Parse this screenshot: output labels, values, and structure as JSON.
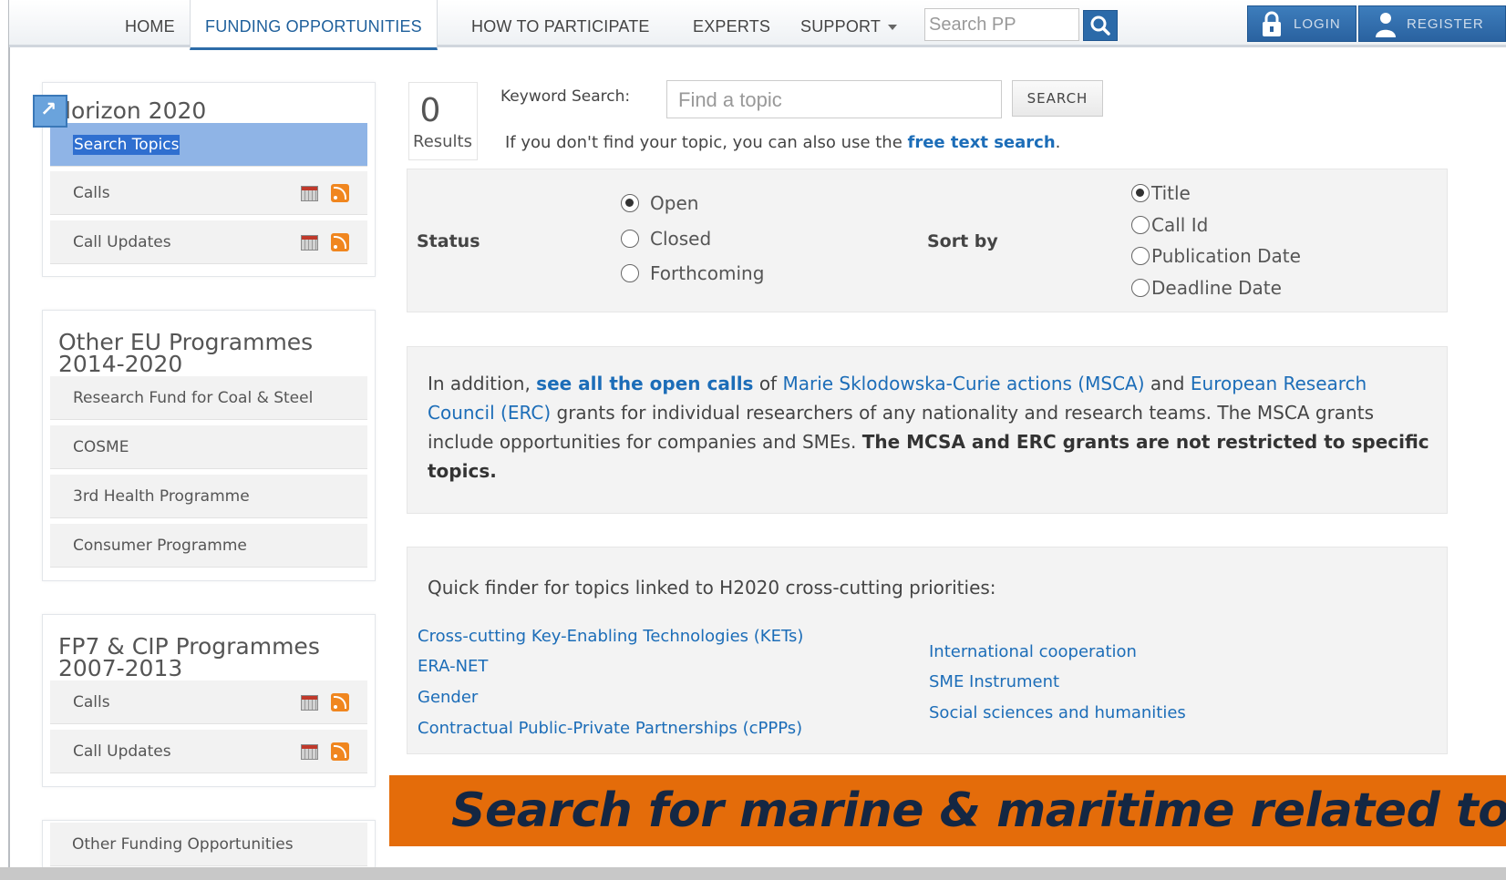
{
  "nav": {
    "items": [
      {
        "label": "HOME",
        "active": false
      },
      {
        "label": "FUNDING OPPORTUNITIES",
        "active": true
      },
      {
        "label": "HOW TO PARTICIPATE",
        "active": false
      },
      {
        "label": "EXPERTS",
        "active": false
      },
      {
        "label": "SUPPORT",
        "active": false
      }
    ],
    "search_placeholder": "Search PP",
    "login_label": "LOGIN",
    "register_label": "REGISTER",
    "accent_color": "#2b6aa9"
  },
  "sidebar": {
    "horizon": {
      "title": "Horizon 2020",
      "title_visible": "lorizon 2020",
      "items": [
        "Search Topics",
        "Calls",
        "Call Updates"
      ]
    },
    "other_eu": {
      "title_line1": "Other EU Programmes",
      "title_line2": "2014-2020",
      "items": [
        "Research Fund for Coal & Steel",
        "COSME",
        "3rd Health Programme",
        "Consumer Programme"
      ]
    },
    "fp7": {
      "title_line1": "FP7 & CIP Programmes",
      "title_line2": "2007-2013",
      "items": [
        "Calls",
        "Call Updates"
      ]
    },
    "other_funding": "Other Funding Opportunities"
  },
  "search": {
    "results_count": "0",
    "results_label": "Results",
    "keyword_label": "Keyword Search:",
    "keyword_placeholder": "Find a topic",
    "search_button": "SEARCH",
    "hint_prefix": "If you don't find your topic, you can also use the",
    "hint_link": "free text search",
    "hint_suffix": "."
  },
  "filters": {
    "status_label": "Status",
    "status_options": [
      "Open",
      "Closed",
      "Forthcoming"
    ],
    "status_selected": "Open",
    "sort_label": "Sort by",
    "sort_options": [
      "Title",
      "Call Id",
      "Publication Date",
      "Deadline Date"
    ],
    "sort_selected": "Title"
  },
  "info": {
    "t1": "In addition,",
    "link1": "see all the open calls",
    "t2": "of",
    "link2": "Marie Sklodowska-Curie actions (MSCA)",
    "t3": "and",
    "link3": "European Research Council (ERC)",
    "t4": "grants for individual researchers of any nationality and research teams. The MSCA grants include opportunities for companies and SMEs.",
    "bold": "The MCSA and ERC grants are not restricted to specific topics."
  },
  "quick": {
    "title": "Quick finder for topics linked to H2020 cross-cutting priorities:",
    "left": [
      "Cross-cutting Key-Enabling Technologies (KETs)",
      "ERA-NET",
      "Gender",
      "Contractual Public-Private Partnerships (cPPPs)"
    ],
    "right": [
      "International cooperation",
      "SME Instrument",
      "Social sciences and humanities"
    ]
  },
  "banner": {
    "text": "Search for marine & maritime related topics",
    "color": "#e46c0a"
  }
}
